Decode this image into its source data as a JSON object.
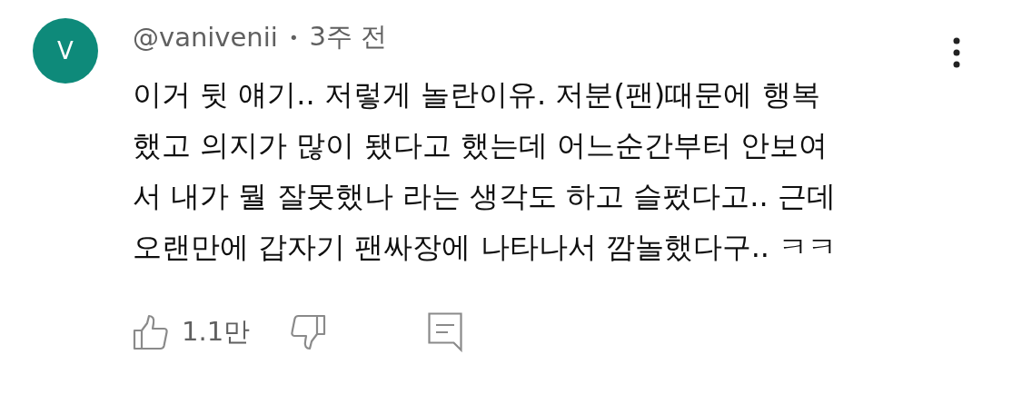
{
  "comment": {
    "avatar_letter": "V",
    "color": "#0e8a7a",
    "author": "@vanivenii",
    "separator": "•",
    "time": "3주 전",
    "text_lines": [
      "이거 뒷 얘기.. 저렇게 놀란이유. 저분(팬)때문에 행복",
      "했고 의지가 많이 됐다고 했는데 어느순간부터 안보여",
      "서 내가 뭘 잘못했나 라는 생각도 하고 슬펐다고.. 근데",
      "오랜만에 갑자기 팬싸장에 나타나서 깜놀했다구.. ㅋㅋ"
    ],
    "like_count": "1.1만"
  }
}
